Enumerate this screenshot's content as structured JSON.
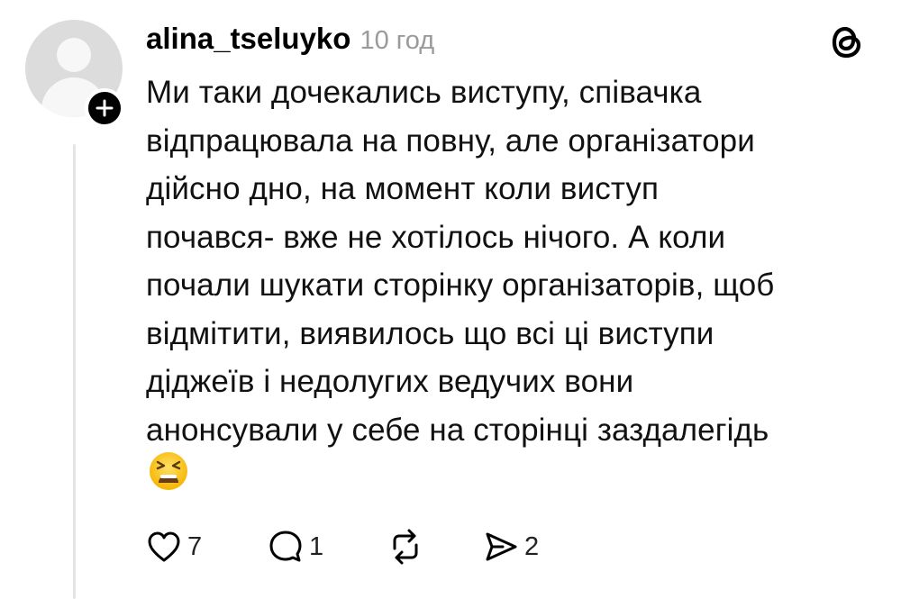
{
  "post": {
    "username": "alina_tseluyko",
    "time": "10 год",
    "lines": [
      "Ми таки дочекались виступу, співачка",
      "відпрацювала на повну, але організатори",
      "дійсно дно, на момент коли виступ",
      "почався- вже не хотілось нічого. А коли",
      "почали шукати сторінку організаторів, щоб",
      "відмітити, виявилось що всі ці виступи",
      "діджеїв і недолугих ведучих вони",
      "анонсували у себе на сторінці заздалегідь"
    ],
    "emoji": "tired-face-emoji"
  },
  "actions": {
    "like_count": "7",
    "reply_count": "1",
    "share_count": "2"
  },
  "icons": [
    "person-avatar-icon",
    "plus-icon",
    "threads-logo-icon",
    "heart-icon",
    "comment-icon",
    "repost-icon",
    "share-icon"
  ],
  "colors": {
    "text": "#000000",
    "muted": "#9a9a9a",
    "avatar_bg": "#dcdcdc",
    "thread_line": "#e5e5e5"
  }
}
